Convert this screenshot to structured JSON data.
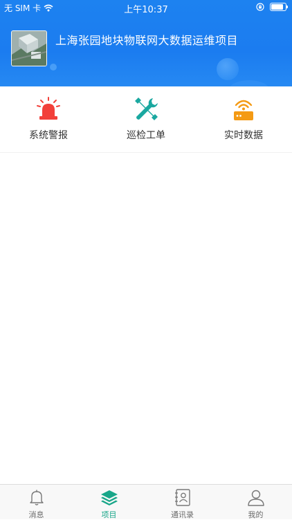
{
  "status_bar": {
    "carrier": "无 SIM 卡",
    "time": "上午10:37"
  },
  "project": {
    "title": "上海张园地块物联网大数据运维项目"
  },
  "menu": {
    "items": [
      {
        "label": "系统警报",
        "icon": "alarm-siren-icon",
        "color": "#f2403a"
      },
      {
        "label": "巡检工单",
        "icon": "tools-icon",
        "color": "#1aa8a0"
      },
      {
        "label": "实时数据",
        "icon": "router-signal-icon",
        "color": "#f49a14"
      }
    ]
  },
  "tabbar": {
    "active_color": "#19a689",
    "tabs": [
      {
        "label": "消息",
        "icon": "bell-icon",
        "active": false
      },
      {
        "label": "项目",
        "icon": "layers-icon",
        "active": true
      },
      {
        "label": "通讯录",
        "icon": "contacts-icon",
        "active": false
      },
      {
        "label": "我的",
        "icon": "user-icon",
        "active": false
      }
    ]
  }
}
